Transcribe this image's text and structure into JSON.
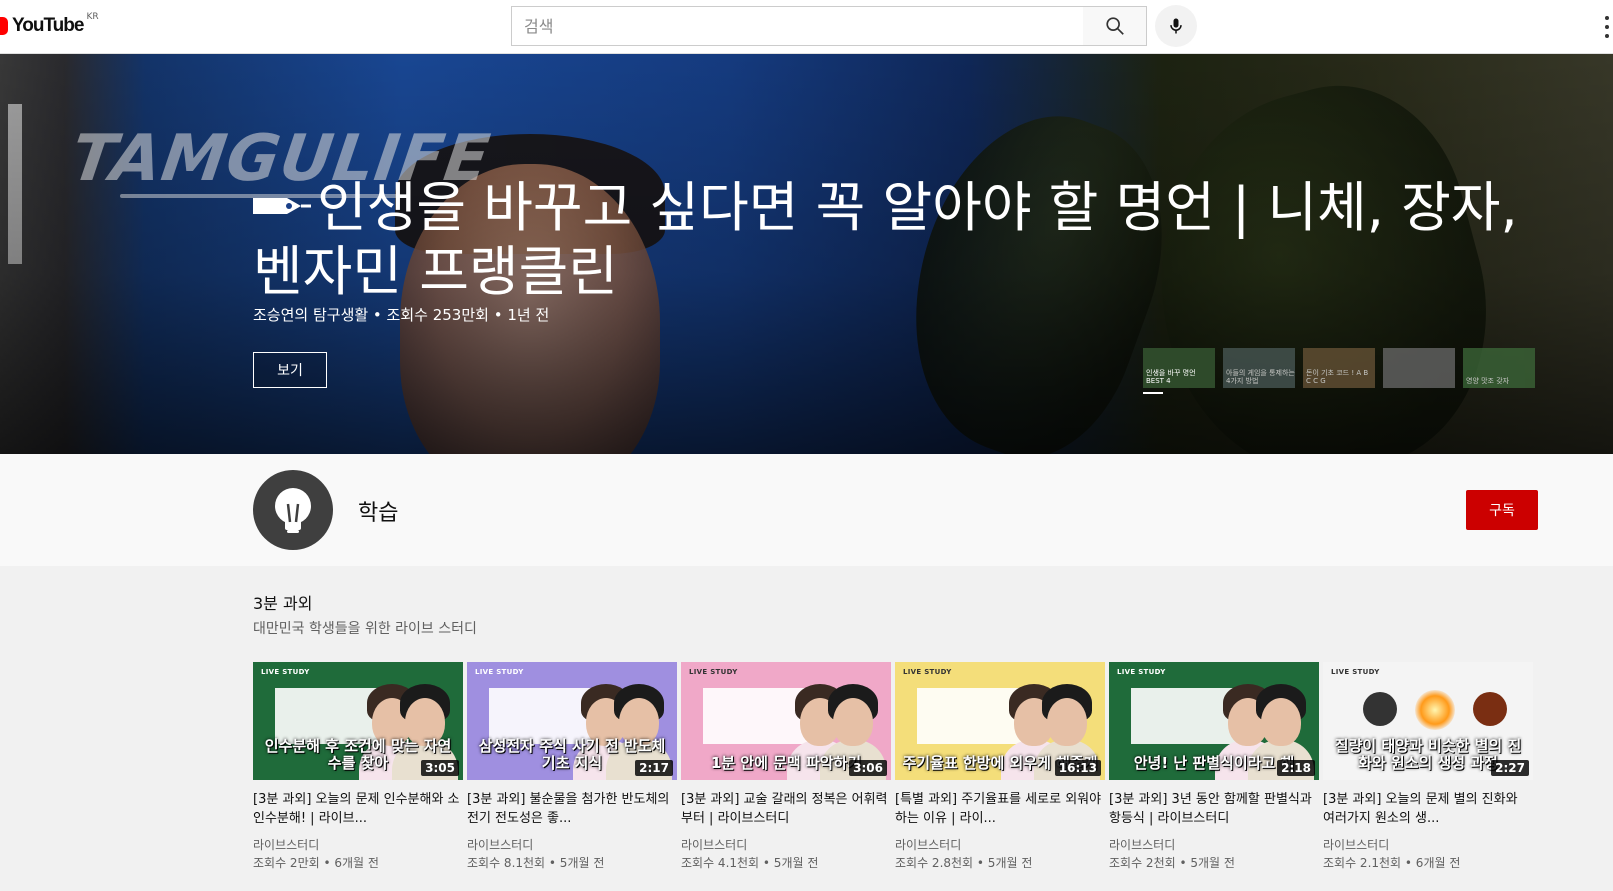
{
  "header": {
    "logo_text": "YouTube",
    "logo_country": "KR",
    "search_placeholder": "검색"
  },
  "banner": {
    "title": "인생을 바꾸고 싶다면 꼭 알아야 할 명언 | 니체, 장자, 벤자민 프랭클린",
    "meta": "조승연의 탐구생활 • 조회수 253만회 • 1년 전",
    "watch_label": "보기",
    "watermark": "TAMGULIFE",
    "thumbnails": [
      {
        "text": "인생을 바꾸 명언 BEST 4",
        "color": "#2e4a2a"
      },
      {
        "text": "아들의 게임을 통제하는 4가지 방법",
        "color": "#4a5a58"
      },
      {
        "text": "돈이 기초 코드 ! A B C C G",
        "color": "#6a5538"
      },
      {
        "text": "",
        "color": "#6b6b6b"
      },
      {
        "text": "영양 맛조 갖자",
        "color": "#3d6a3a"
      }
    ]
  },
  "channel": {
    "name": "학습",
    "subscribe_label": "구독"
  },
  "section": {
    "title": "3분 과외",
    "subtitle": "대만민국 학생들을 위한 라이브 스터디"
  },
  "videos": [
    {
      "thumb_caption": "인수분해 후 조건에 맞는 자연수를 찾아",
      "bg": "#1f6b3a",
      "duration": "3:05",
      "title": "[3분 과외] 오늘의 문제 인수분해와 소인수분해! | 라이브...",
      "channel": "라이브스터디",
      "meta": "조회수 2만회 • 6개월 전"
    },
    {
      "thumb_caption": "삼성전자 주식 사기 전 반도체 기초 지식",
      "bg": "#9f8fe0",
      "duration": "2:17",
      "title": "[3분 과외] 불순물을 첨가한 반도체의 전기 전도성은 좋...",
      "channel": "라이브스터디",
      "meta": "조회수 8.1천회 • 5개월 전"
    },
    {
      "thumb_caption": "1분 안에 문맥 파악하기",
      "bg": "#f0a8c8",
      "duration": "3:06",
      "title": "[3분 과외] 교술 갈래의 정복은 어휘력부터 | 라이브스터디",
      "channel": "라이브스터디",
      "meta": "조회수 4.1천회 • 5개월 전"
    },
    {
      "thumb_caption": "주기율표 한방에 외우게 해줄게",
      "bg": "#f4de7a",
      "duration": "16:13",
      "title": "[특별 과외] 주기율표를 세로로 외워야 하는 이유 | 라이...",
      "channel": "라이브스터디",
      "meta": "조회수 2.8천회 • 5개월 전"
    },
    {
      "thumb_caption": "안녕! 난 판별식이라고 해",
      "bg": "#1f6b3a",
      "duration": "2:18",
      "title": "[3분 과외] 3년 동안 함께할 판별식과 항등식 | 라이브스터디",
      "channel": "라이브스터디",
      "meta": "조회수 2천회 • 5개월 전"
    },
    {
      "thumb_caption": "질량이 태양과 비슷한 별의 진화와 원소의 생성 과정",
      "bg": "#f4f4f4",
      "duration": "2:27",
      "title": "[3분 과외] 오늘의 문제 별의 진화와 여러가지 원소의 생...",
      "channel": "라이브스터디",
      "meta": "조회수 2.1천회 • 6개월 전"
    }
  ]
}
